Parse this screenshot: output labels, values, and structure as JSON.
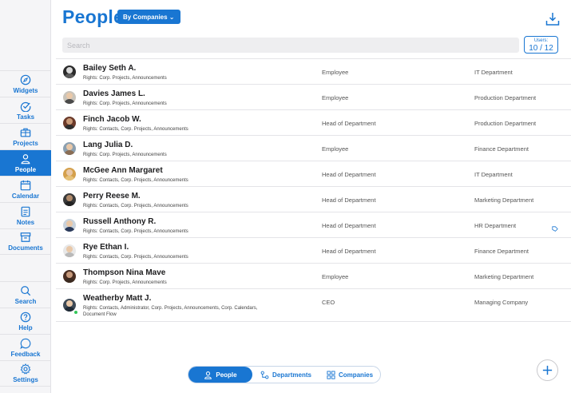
{
  "header": {
    "title": "People",
    "by_label": "By Companies ⌄"
  },
  "search": {
    "placeholder": "Search"
  },
  "users": {
    "label": "Users:",
    "value": "10 / 12"
  },
  "sidebar": {
    "items": [
      {
        "label": "Widgets",
        "icon": "compass-icon"
      },
      {
        "label": "Tasks",
        "icon": "check-circle-icon"
      },
      {
        "label": "Projects",
        "icon": "briefcase-icon"
      },
      {
        "label": "People",
        "icon": "person-icon",
        "active": true
      },
      {
        "label": "Calendar",
        "icon": "calendar-icon"
      },
      {
        "label": "Notes",
        "icon": "note-icon"
      },
      {
        "label": "Documents",
        "icon": "archive-icon"
      }
    ],
    "bottom": [
      {
        "label": "Search",
        "icon": "search-icon"
      },
      {
        "label": "Help",
        "icon": "help-icon"
      },
      {
        "label": "Feedback",
        "icon": "feedback-icon"
      },
      {
        "label": "Settings",
        "icon": "gear-icon"
      }
    ]
  },
  "people": [
    {
      "name": "Bailey Seth A.",
      "rights": "Rights: Corp. Projects, Announcements",
      "role": "Employee",
      "dept": "IT Department"
    },
    {
      "name": "Davies James L.",
      "rights": "Rights: Corp. Projects, Announcements",
      "role": "Employee",
      "dept": "Production Department"
    },
    {
      "name": "Finch Jacob W.",
      "rights": "Rights: Contacts, Corp. Projects, Announcements",
      "role": "Head of Department",
      "dept": "Production Department"
    },
    {
      "name": "Lang Julia D.",
      "rights": "Rights: Corp. Projects, Announcements",
      "role": "Employee",
      "dept": "Finance Department"
    },
    {
      "name": "McGee Ann Margaret",
      "rights": "Rights: Contacts, Corp. Projects, Announcements",
      "role": "Head of Department",
      "dept": "IT Department"
    },
    {
      "name": "Perry Reese M.",
      "rights": "Rights: Contacts, Corp. Projects, Announcements",
      "role": "Head of Department",
      "dept": "Marketing Department"
    },
    {
      "name": "Russell Anthony R.",
      "rights": "Rights: Contacts, Corp. Projects, Announcements",
      "role": "Head of Department",
      "dept": "HR Department"
    },
    {
      "name": "Rye Ethan I.",
      "rights": "Rights: Contacts, Corp. Projects, Announcements",
      "role": "Head of Department",
      "dept": "Finance Department"
    },
    {
      "name": "Thompson Nina Mave",
      "rights": "Rights: Corp. Projects, Announcements",
      "role": "Employee",
      "dept": "Marketing Department"
    },
    {
      "name": "Weatherby Matt J.",
      "rights": "Rights: Contacts, Administrator, Corp. Projects, Announcements, Corp. Calendars, Document Flow",
      "role": "CEO",
      "dept": "Managing Company"
    }
  ],
  "switcher": {
    "people": "People",
    "departments": "Departments",
    "companies": "Companies"
  },
  "colors": {
    "accent": "#1976d2",
    "online": "#34c759"
  }
}
